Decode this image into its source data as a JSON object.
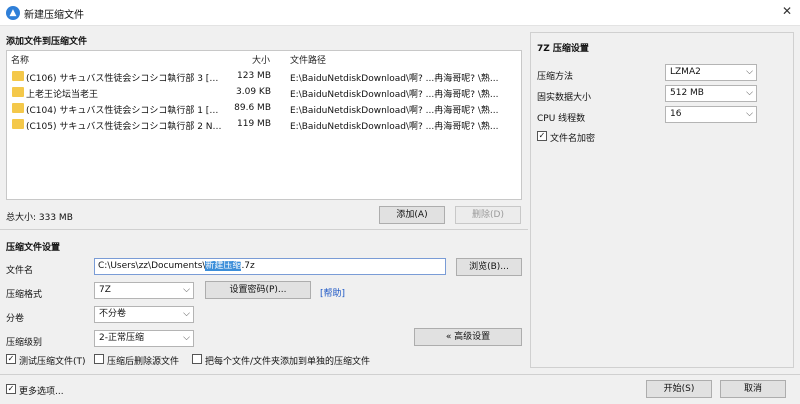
{
  "window": {
    "title": "新建压缩文件",
    "close_glyph": "✕",
    "app_icon": "archive-app-icon"
  },
  "files_section": {
    "title": "添加文件到压缩文件",
    "columns": {
      "name": "名称",
      "size": "大小",
      "path": "文件路径"
    },
    "rows": [
      {
        "name": "(C106) サキュバス性徒会シコシコ執行部 3 [無邪...",
        "size": "123 MB",
        "path": "E:\\BaiduNetdiskDownload\\啊? ...冉海哥呢? \\熟..."
      },
      {
        "name": "上老王论坛当老王",
        "size": "3.09 KB",
        "path": "E:\\BaiduNetdiskDownload\\啊? ...冉海哥呢? \\熟..."
      },
      {
        "name": "(C104) サキュバス性徒会シコシコ執行部 1 [無邪...",
        "size": "89.6 MB",
        "path": "E:\\BaiduNetdiskDownload\\啊? ...冉海哥呢? \\熟..."
      },
      {
        "name": "(C105) サキュバス性徒会シコシコ執行部 2 NOA...",
        "size": "119 MB",
        "path": "E:\\BaiduNetdiskDownload\\啊? ...冉海哥呢? \\熟..."
      }
    ],
    "total_size": "总大小: 333 MB",
    "add_button": "添加(A)",
    "delete_button": "删除(D)"
  },
  "archive_settings": {
    "title": "压缩文件设置",
    "filename_label": "文件名",
    "filename_prefix": "C:\\Users\\zz\\Documents\\",
    "filename_selected": "新建压缩",
    "filename_suffix": ".7z",
    "browse_button": "浏览(B)...",
    "format_label": "压缩格式",
    "format_value": "7Z",
    "password_button": "设置密码(P)...",
    "help_link": "[帮助]",
    "split_label": "分卷",
    "split_value": "不分卷",
    "level_label": "压缩级别",
    "level_value": "2-正常压缩",
    "advanced_button": "« 高级设置",
    "test_checkbox": "测试压缩文件(T)",
    "delete_after_checkbox": "压缩后删除源文件",
    "separate_checkbox": "把每个文件/文件夹添加到单独的压缩文件"
  },
  "seven_z": {
    "title": "7Z 压缩设置",
    "method_label": "压缩方法",
    "method_value": "LZMA2",
    "block_label": "固实数据大小",
    "block_value": "512 MB",
    "threads_label": "CPU 线程数",
    "threads_value": "16",
    "encrypt_names": "文件名加密"
  },
  "footer": {
    "more_options": "更多选项...",
    "start_button": "开始(S)",
    "cancel_button": "取消"
  }
}
